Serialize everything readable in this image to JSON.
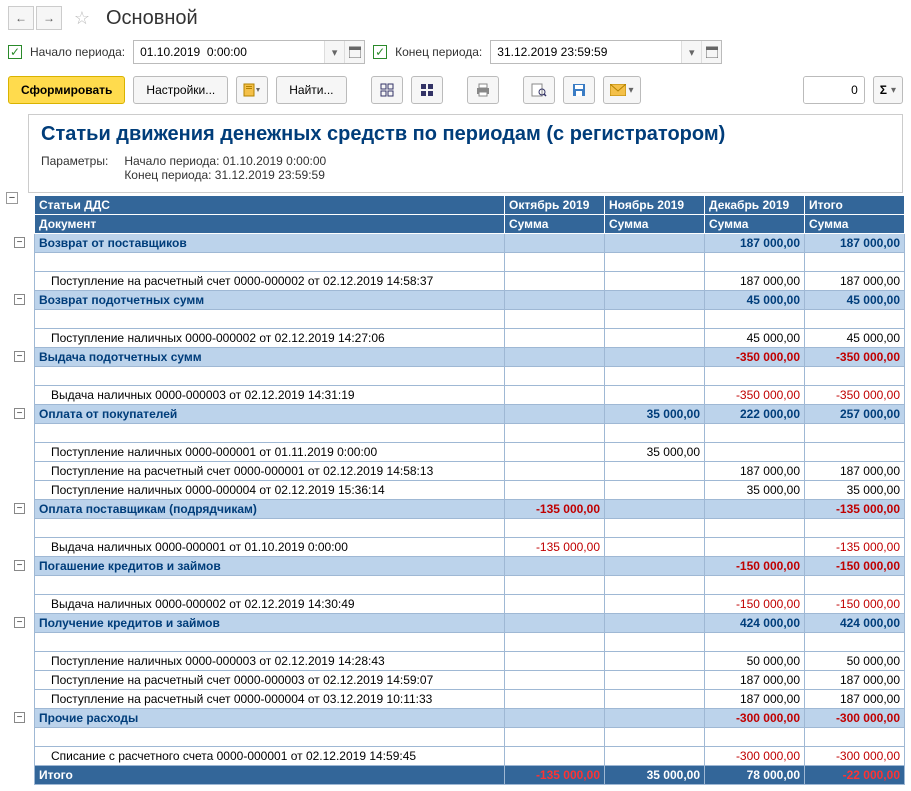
{
  "nav": {
    "title": "Основной"
  },
  "period": {
    "start_label": "Начало периода:",
    "end_label": "Конец периода:",
    "start_value": "01.10.2019  0:00:00",
    "end_value": "31.12.2019 23:59:59"
  },
  "toolbar": {
    "generate": "Сформировать",
    "settings": "Настройки...",
    "find": "Найти...",
    "sum_value": "0",
    "sigma": "Σ"
  },
  "report": {
    "title": "Статьи движения денежных средств по периодам (с регистратором)",
    "params_label": "Параметры:",
    "param1": "Начало периода: 01.10.2019 0:00:00",
    "param2": "Конец периода: 31.12.2019 23:59:59"
  },
  "table": {
    "headers": {
      "group": "Статьи ДДС",
      "doc": "Документ",
      "periods": [
        "Октябрь 2019",
        "Ноябрь 2019",
        "Декабрь 2019",
        "Итого"
      ],
      "sub": "Сумма"
    },
    "groups": [
      {
        "name": "Возврат от поставщиков",
        "vals": [
          "",
          "",
          "187 000,00",
          "187 000,00"
        ],
        "neg": [
          false,
          false,
          false,
          false
        ],
        "docs": [
          {
            "name": "Поступление на расчетный счет 0000-000002 от 02.12.2019 14:58:37",
            "vals": [
              "",
              "",
              "187 000,00",
              "187 000,00"
            ],
            "neg": [
              false,
              false,
              false,
              false
            ]
          }
        ]
      },
      {
        "name": "Возврат подотчетных сумм",
        "vals": [
          "",
          "",
          "45 000,00",
          "45 000,00"
        ],
        "neg": [
          false,
          false,
          false,
          false
        ],
        "docs": [
          {
            "name": "Поступление наличных 0000-000002 от 02.12.2019 14:27:06",
            "vals": [
              "",
              "",
              "45 000,00",
              "45 000,00"
            ],
            "neg": [
              false,
              false,
              false,
              false
            ]
          }
        ]
      },
      {
        "name": "Выдача подотчетных сумм",
        "vals": [
          "",
          "",
          "-350 000,00",
          "-350 000,00"
        ],
        "neg": [
          false,
          false,
          true,
          true
        ],
        "docs": [
          {
            "name": "Выдача наличных 0000-000003 от 02.12.2019 14:31:19",
            "vals": [
              "",
              "",
              "-350 000,00",
              "-350 000,00"
            ],
            "neg": [
              false,
              false,
              true,
              true
            ]
          }
        ]
      },
      {
        "name": "Оплата от покупателей",
        "vals": [
          "",
          "35 000,00",
          "222 000,00",
          "257 000,00"
        ],
        "neg": [
          false,
          false,
          false,
          false
        ],
        "docs": [
          {
            "name": "Поступление наличных 0000-000001 от 01.11.2019 0:00:00",
            "vals": [
              "",
              "35 000,00",
              "",
              ""
            ],
            "neg": [
              false,
              false,
              false,
              false
            ]
          },
          {
            "name": "Поступление на расчетный счет 0000-000001 от 02.12.2019 14:58:13",
            "vals": [
              "",
              "",
              "187 000,00",
              "187 000,00"
            ],
            "neg": [
              false,
              false,
              false,
              false
            ]
          },
          {
            "name": "Поступление наличных 0000-000004 от 02.12.2019 15:36:14",
            "vals": [
              "",
              "",
              "35 000,00",
              "35 000,00"
            ],
            "neg": [
              false,
              false,
              false,
              false
            ]
          }
        ]
      },
      {
        "name": "Оплата поставщикам (подрядчикам)",
        "vals": [
          "-135 000,00",
          "",
          "",
          "-135 000,00"
        ],
        "neg": [
          true,
          false,
          false,
          true
        ],
        "docs": [
          {
            "name": "Выдача наличных 0000-000001 от 01.10.2019 0:00:00",
            "vals": [
              "-135 000,00",
              "",
              "",
              "-135 000,00"
            ],
            "neg": [
              true,
              false,
              false,
              true
            ]
          }
        ]
      },
      {
        "name": "Погашение кредитов и займов",
        "vals": [
          "",
          "",
          "-150 000,00",
          "-150 000,00"
        ],
        "neg": [
          false,
          false,
          true,
          true
        ],
        "docs": [
          {
            "name": "Выдача наличных 0000-000002 от 02.12.2019 14:30:49",
            "vals": [
              "",
              "",
              "-150 000,00",
              "-150 000,00"
            ],
            "neg": [
              false,
              false,
              true,
              true
            ]
          }
        ]
      },
      {
        "name": "Получение кредитов и займов",
        "vals": [
          "",
          "",
          "424 000,00",
          "424 000,00"
        ],
        "neg": [
          false,
          false,
          false,
          false
        ],
        "docs": [
          {
            "name": "Поступление наличных 0000-000003 от 02.12.2019 14:28:43",
            "vals": [
              "",
              "",
              "50 000,00",
              "50 000,00"
            ],
            "neg": [
              false,
              false,
              false,
              false
            ]
          },
          {
            "name": "Поступление на расчетный счет 0000-000003 от 02.12.2019 14:59:07",
            "vals": [
              "",
              "",
              "187 000,00",
              "187 000,00"
            ],
            "neg": [
              false,
              false,
              false,
              false
            ]
          },
          {
            "name": "Поступление на расчетный счет 0000-000004 от 03.12.2019 10:11:33",
            "vals": [
              "",
              "",
              "187 000,00",
              "187 000,00"
            ],
            "neg": [
              false,
              false,
              false,
              false
            ]
          }
        ]
      },
      {
        "name": "Прочие расходы",
        "vals": [
          "",
          "",
          "-300 000,00",
          "-300 000,00"
        ],
        "neg": [
          false,
          false,
          true,
          true
        ],
        "docs": [
          {
            "name": "Списание с расчетного счета 0000-000001 от 02.12.2019 14:59:45",
            "vals": [
              "",
              "",
              "-300 000,00",
              "-300 000,00"
            ],
            "neg": [
              false,
              false,
              true,
              true
            ]
          }
        ]
      }
    ],
    "total": {
      "name": "Итого",
      "vals": [
        "-135 000,00",
        "35 000,00",
        "78 000,00",
        "-22 000,00"
      ],
      "neg": [
        true,
        false,
        false,
        true
      ]
    }
  },
  "chart_data": {
    "type": "table",
    "title": "Статьи движения денежных средств по периодам (с регистратором)",
    "columns": [
      "Статьи ДДС / Документ",
      "Октябрь 2019",
      "Ноябрь 2019",
      "Декабрь 2019",
      "Итого"
    ],
    "rows": [
      [
        "Возврат от поставщиков",
        null,
        null,
        187000.0,
        187000.0
      ],
      [
        "Возврат подотчетных сумм",
        null,
        null,
        45000.0,
        45000.0
      ],
      [
        "Выдача подотчетных сумм",
        null,
        null,
        -350000.0,
        -350000.0
      ],
      [
        "Оплата от покупателей",
        null,
        35000.0,
        222000.0,
        257000.0
      ],
      [
        "Оплата поставщикам (подрядчикам)",
        -135000.0,
        null,
        null,
        -135000.0
      ],
      [
        "Погашение кредитов и займов",
        null,
        null,
        -150000.0,
        -150000.0
      ],
      [
        "Получение кредитов и займов",
        null,
        null,
        424000.0,
        424000.0
      ],
      [
        "Прочие расходы",
        null,
        null,
        -300000.0,
        -300000.0
      ],
      [
        "Итого",
        -135000.0,
        35000.0,
        78000.0,
        -22000.0
      ]
    ]
  }
}
